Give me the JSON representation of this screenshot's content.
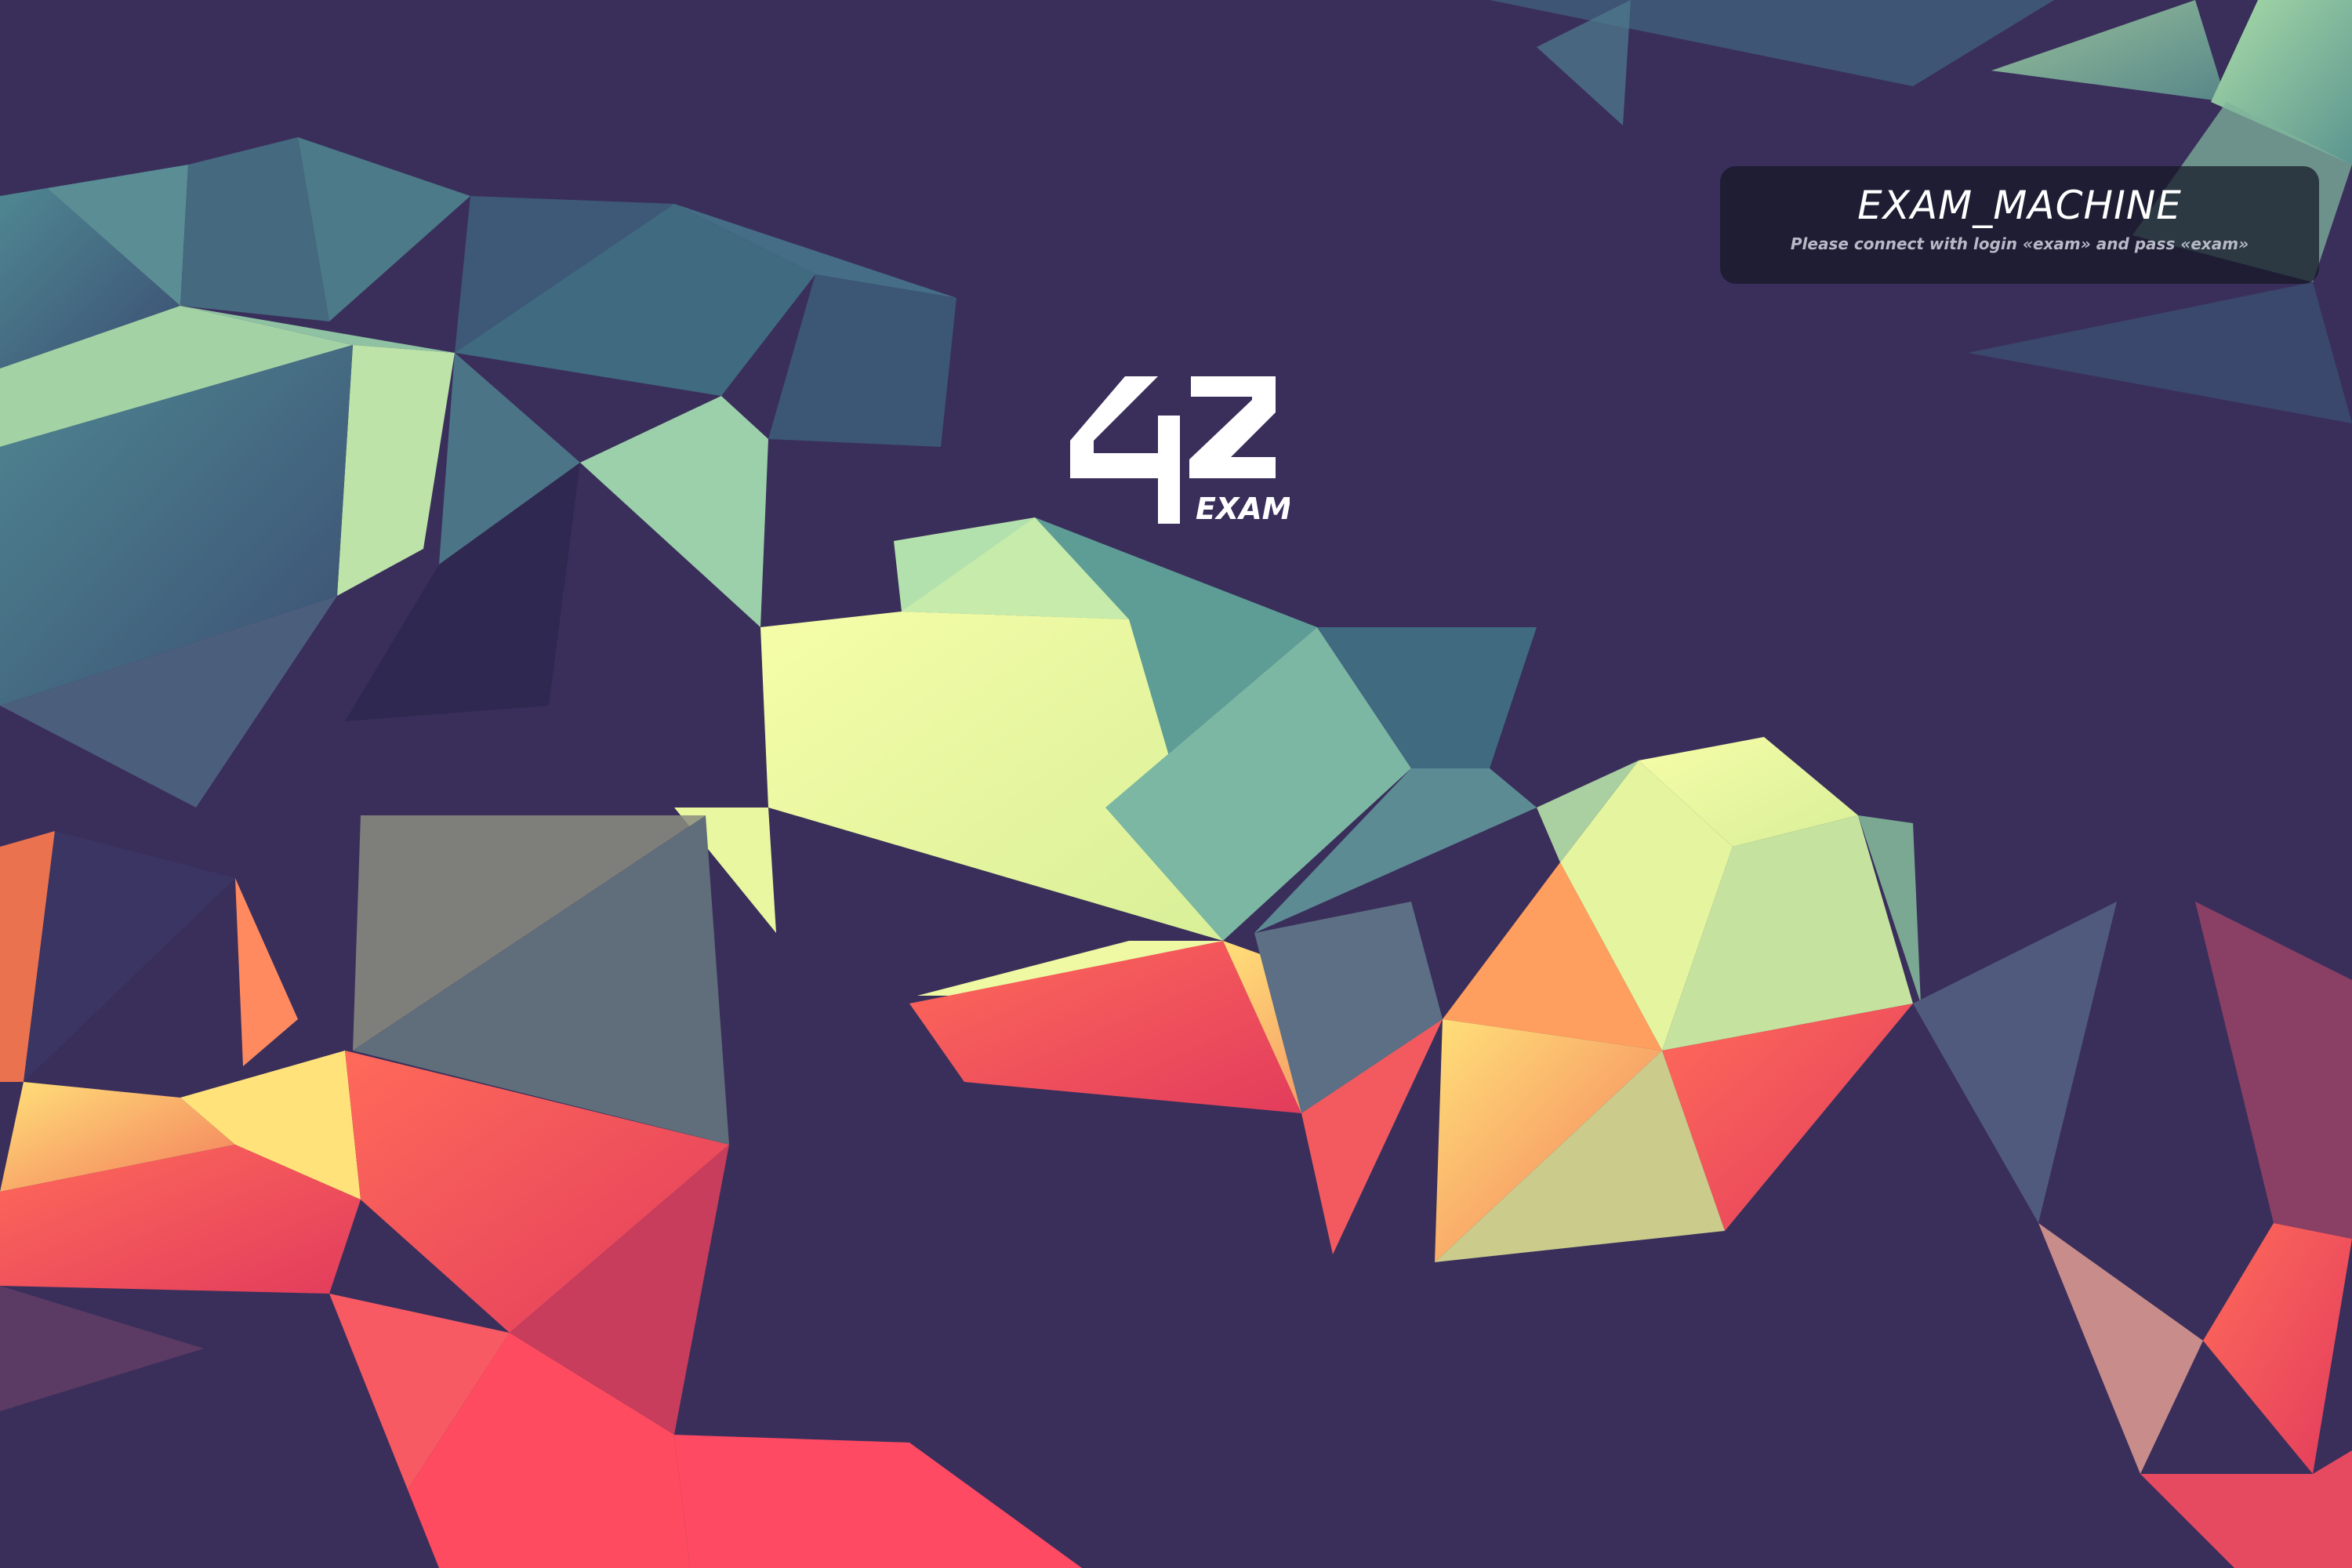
{
  "desktop": {
    "wallpaper": "low-poly-gradient-wallpaper",
    "background_color": "#3a2f5b",
    "accent_colors": [
      "#e7f8a0",
      "#a6d9a4",
      "#3f6b7e",
      "#ff5a62",
      "#ffc56a",
      "#f07a5a"
    ]
  },
  "logo": {
    "brand": "42",
    "label": "EXAM"
  },
  "login_panel": {
    "title": "EXAM_MACHINE",
    "hint": "Please connect  with login «exam» and pass «exam»"
  }
}
